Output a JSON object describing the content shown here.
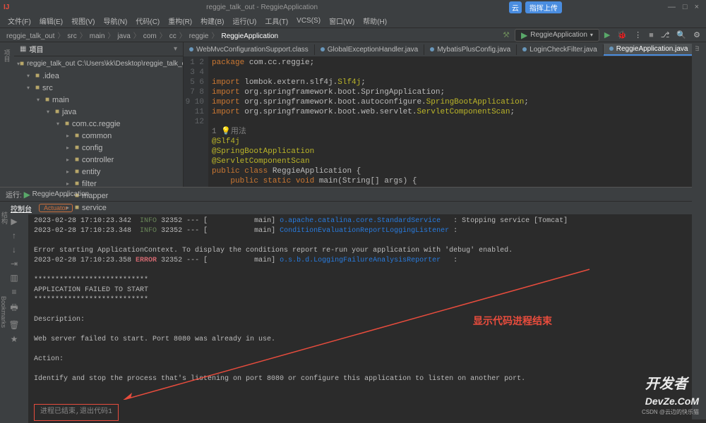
{
  "titlebar": {
    "text": "reggie_talk_out - ReggieApplication",
    "badge_icon": "云",
    "badge": "指挥上传"
  },
  "window_controls": {
    "min": "—",
    "max": "□",
    "close": "×"
  },
  "menu": [
    "文件(F)",
    "编辑(E)",
    "视图(V)",
    "导航(N)",
    "代码(C)",
    "重构(R)",
    "构建(B)",
    "运行(U)",
    "工具(T)",
    "VCS(S)",
    "窗口(W)",
    "帮助(H)"
  ],
  "breadcrumb": [
    "reggie_talk_out",
    "src",
    "main",
    "java",
    "com",
    "cc",
    "reggie",
    "ReggieApplication"
  ],
  "run_config": "ReggieApplication",
  "project": {
    "label": "项目",
    "root": "reggie_talk_out C:\\Users\\kk\\Desktop\\reggie_talk_out",
    "tree": [
      {
        "depth": 1,
        "arrow": "▾",
        "name": ".idea"
      },
      {
        "depth": 1,
        "arrow": "▾",
        "name": "src"
      },
      {
        "depth": 2,
        "arrow": "▾",
        "name": "main"
      },
      {
        "depth": 3,
        "arrow": "▾",
        "name": "java"
      },
      {
        "depth": 4,
        "arrow": "▾",
        "name": "com.cc.reggie"
      },
      {
        "depth": 5,
        "arrow": "▸",
        "name": "common"
      },
      {
        "depth": 5,
        "arrow": "▸",
        "name": "config"
      },
      {
        "depth": 5,
        "arrow": "▸",
        "name": "controller"
      },
      {
        "depth": 5,
        "arrow": "▸",
        "name": "entity"
      },
      {
        "depth": 5,
        "arrow": "▸",
        "name": "filter"
      },
      {
        "depth": 5,
        "arrow": "▸",
        "name": "mapper"
      },
      {
        "depth": 5,
        "arrow": "▸",
        "name": "service"
      }
    ]
  },
  "tabs": [
    {
      "name": "WebMvcConfigurationSupport.class",
      "active": false
    },
    {
      "name": "GlobalExceptionHandler.java",
      "active": false
    },
    {
      "name": "MybatisPlusConfig.java",
      "active": false
    },
    {
      "name": "LoginCheckFilter.java",
      "active": false
    },
    {
      "name": "ReggieApplication.java",
      "active": true
    }
  ],
  "code": {
    "lines": [
      1,
      2,
      3,
      4,
      5,
      6,
      7,
      8,
      9,
      10,
      11,
      12
    ],
    "text": [
      {
        "t": "package ",
        "c": "kw"
      },
      {
        "t": "com.cc.reggie;\n\n"
      },
      {
        "t": "import ",
        "c": "kw"
      },
      {
        "t": "lombok.extern.slf4j."
      },
      {
        "t": "Slf4j",
        "c": "ann"
      },
      {
        "t": ";\n"
      },
      {
        "t": "import ",
        "c": "kw"
      },
      {
        "t": "org.springframework.boot.SpringApplication;\n"
      },
      {
        "t": "import ",
        "c": "kw"
      },
      {
        "t": "org.springframework.boot.autoconfigure."
      },
      {
        "t": "SpringBootApplication",
        "c": "ann"
      },
      {
        "t": ";\n"
      },
      {
        "t": "import ",
        "c": "kw"
      },
      {
        "t": "org.springframework.boot.web.servlet."
      },
      {
        "t": "ServletComponentScan",
        "c": "ann"
      },
      {
        "t": ";\n\n"
      },
      {
        "t": "1 💡用法\n",
        "c": "gray"
      },
      {
        "t": "@Slf4j\n",
        "c": "ann"
      },
      {
        "t": "@SpringBootApplication\n",
        "c": "ann"
      },
      {
        "t": "@ServletComponentScan\n",
        "c": "ann"
      },
      {
        "t": "public class ",
        "c": "kw"
      },
      {
        "t": "ReggieApplication {\n"
      },
      {
        "t": "    public static void ",
        "c": "kw"
      },
      {
        "t": "main(String[] args) {\n"
      }
    ]
  },
  "run": {
    "label": "运行:",
    "name": "ReggieApplication",
    "tabs": {
      "console": "控制台",
      "actuator": "Actuator"
    }
  },
  "console": {
    "l1_time": "2023-02-28 17:10:23.342",
    "l1_level": "INFO",
    "l1_pid": "32352 --- [           main] ",
    "l1_class": "o.apache.catalina.core.StandardService",
    "l1_msg": "   : Stopping service [Tomcat]",
    "l2_time": "2023-02-28 17:10:23.348",
    "l2_level": "INFO",
    "l2_pid": "32352 --- [           main] ",
    "l2_class": "ConditionEvaluationReportLoggingListener",
    "l2_msg": " :",
    "l3": "Error starting ApplicationContext. To display the conditions report re-run your application with 'debug' enabled.",
    "l4_time": "2023-02-28 17:10:23.358",
    "l4_level": "ERROR",
    "l4_pid": "32352 --- [           main] ",
    "l4_class": "o.s.b.d.LoggingFailureAnalysisReporter",
    "l4_msg": "   :",
    "stars": "***************************",
    "failed": "APPLICATION FAILED TO START",
    "desc_h": "Description:",
    "desc": "Web server failed to start. Port 8080 was already in use.",
    "act_h": "Action:",
    "act": "Identify and stop the process that's listening on port 8080 or configure this application to listen on another port.",
    "exit": "进程已结束,退出代码1"
  },
  "annotation": "显示代码进程结束",
  "watermark": "开发者",
  "watermark_sub": "DevZe.CoM",
  "csdn": "CSDN @云边的快乐猫",
  "left_labels": {
    "structure": "结构",
    "bookmarks": "Bookmarks"
  },
  "right_label": "m"
}
